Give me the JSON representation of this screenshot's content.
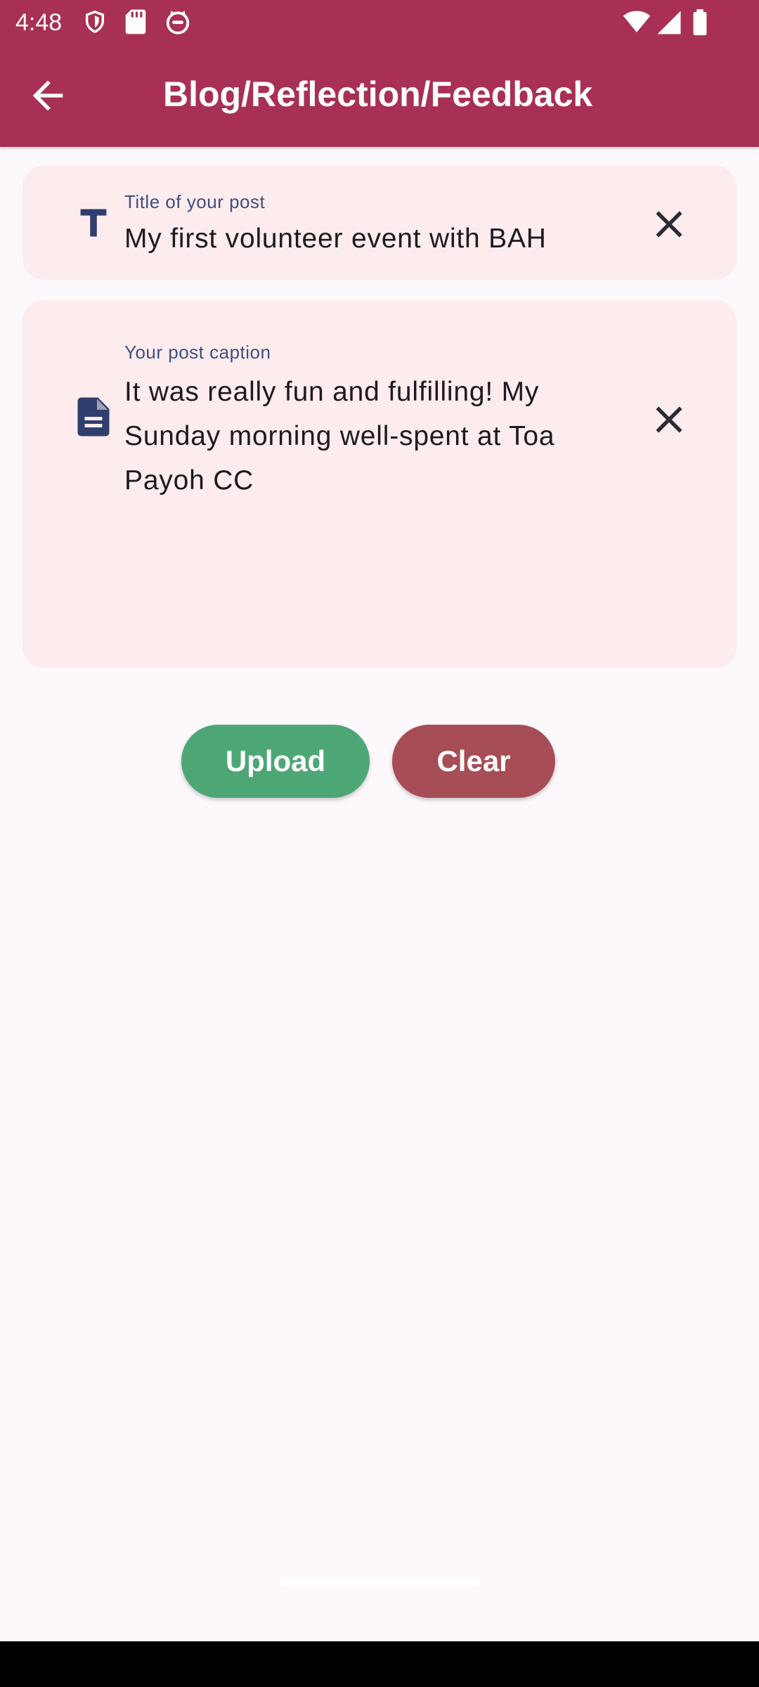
{
  "status_bar": {
    "time": "4:48",
    "left_icons": [
      "shield-icon",
      "sd-card-icon",
      "cat-face-icon"
    ],
    "right_icons": [
      "wifi-icon",
      "cellular-signal-icon",
      "battery-icon"
    ]
  },
  "app_bar": {
    "title": "Blog/Reflection/Feedback",
    "back_icon": "arrow-back-icon",
    "background": "#a83054"
  },
  "form": {
    "title_field": {
      "icon": "text-title-icon",
      "label": "Title of your post",
      "value": "My first volunteer event with BAH",
      "clear_icon": "close-icon"
    },
    "caption_field": {
      "icon": "document-icon",
      "label": "Your post caption",
      "value": "It was really fun and fulfilling! My Sunday morning well-spent at Toa Payoh CC",
      "clear_icon": "close-icon"
    }
  },
  "actions": {
    "upload_label": "Upload",
    "upload_color": "#4da775",
    "clear_label": "Clear",
    "clear_color": "#a74d55"
  },
  "colors": {
    "field_background": "#fdeced",
    "page_background": "#fdf8fb",
    "icon_color": "#303e6d",
    "label_color": "#3e4f82"
  }
}
